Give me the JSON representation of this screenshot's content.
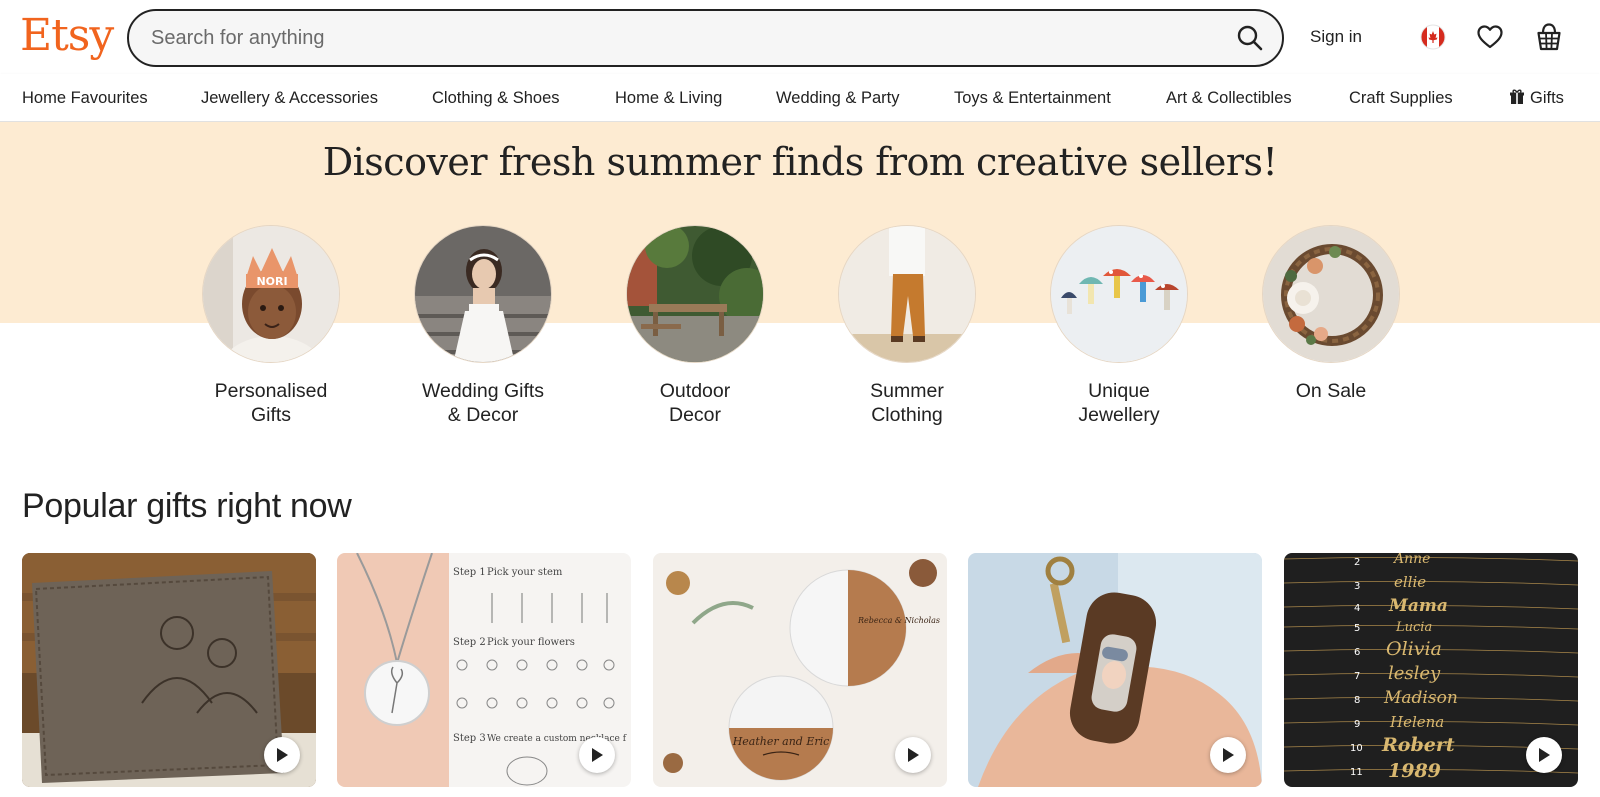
{
  "header": {
    "logo": "Etsy",
    "search_placeholder": "Search for anything",
    "sign_in": "Sign in",
    "icons": [
      "search-icon",
      "canada-flag-icon",
      "heart-icon",
      "basket-icon"
    ]
  },
  "nav": {
    "items": [
      "Home Favourites",
      "Jewellery & Accessories",
      "Clothing & Shoes",
      "Home & Living",
      "Wedding & Party",
      "Toys & Entertainment",
      "Art & Collectibles",
      "Craft Supplies",
      "Gifts"
    ]
  },
  "hero": {
    "title": "Discover fresh summer finds from creative sellers!",
    "categories": [
      {
        "line1": "Personalised",
        "line2": "Gifts"
      },
      {
        "line1": "Wedding Gifts",
        "line2": "& Decor"
      },
      {
        "line1": "Outdoor",
        "line2": "Decor"
      },
      {
        "line1": "Summer",
        "line2": "Clothing"
      },
      {
        "line1": "Unique",
        "line2": "Jewellery"
      },
      {
        "line1": "On Sale",
        "line2": ""
      }
    ],
    "crown_text": "NORI"
  },
  "popular": {
    "title": "Popular gifts right now",
    "necklace_steps": [
      "Step 1",
      "Pick your stem",
      "Step 2",
      "Pick your flowers",
      "Step 3",
      "We create a custom necklace f"
    ],
    "coaster_names": [
      "Rebecca & Nicholas",
      "Heather and Eric"
    ],
    "names_list": [
      "2",
      "3",
      "4",
      "5",
      "6",
      "7",
      "8",
      "9",
      "10",
      "11"
    ],
    "names_script": [
      "Anne",
      "ellie",
      "Mama",
      "Lucia",
      "Olivia",
      "lesley",
      "Madison",
      "Helena",
      "Robert",
      "1989"
    ]
  },
  "colors": {
    "brand": "#F1641E",
    "hero_bg": "#FDEBD2",
    "text": "#222222"
  }
}
